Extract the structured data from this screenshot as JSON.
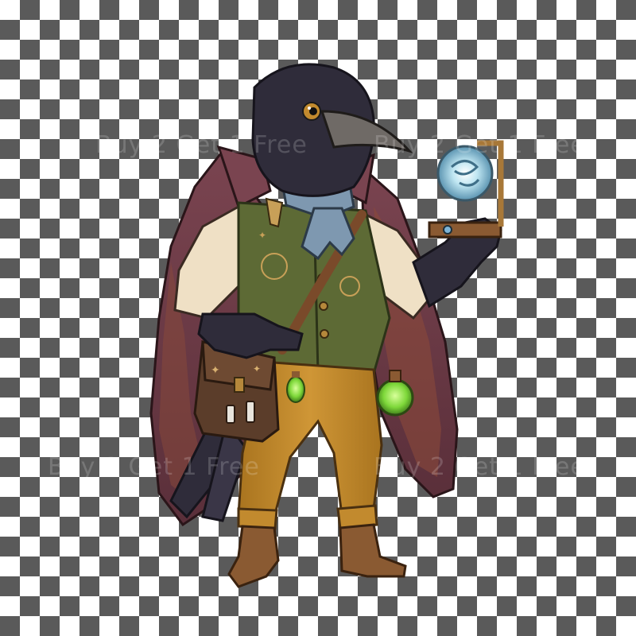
{
  "background": {
    "type": "transparency-checkerboard",
    "dark": "#5a5a5a",
    "light": "#ffffff"
  },
  "watermark": {
    "text_left": "Buy 2 Get 1 Free",
    "text_right": "Buy 2 Get 1 Free"
  },
  "character": {
    "subject": "anthropomorphic crow adventurer",
    "colors": {
      "feathers": "#2f2c3a",
      "beak": "#6f6a66",
      "cape": "#6e3b45",
      "cape_inner": "#8a4a3a",
      "vest": "#5d6a35",
      "shirt": "#efe0c5",
      "scarf": "#7e98b0",
      "trousers": "#c28a2e",
      "boots": "#8a5a32",
      "satchel": "#5b3d2a",
      "potion": "#7ed83a",
      "orb": "#bfe6f2"
    }
  }
}
